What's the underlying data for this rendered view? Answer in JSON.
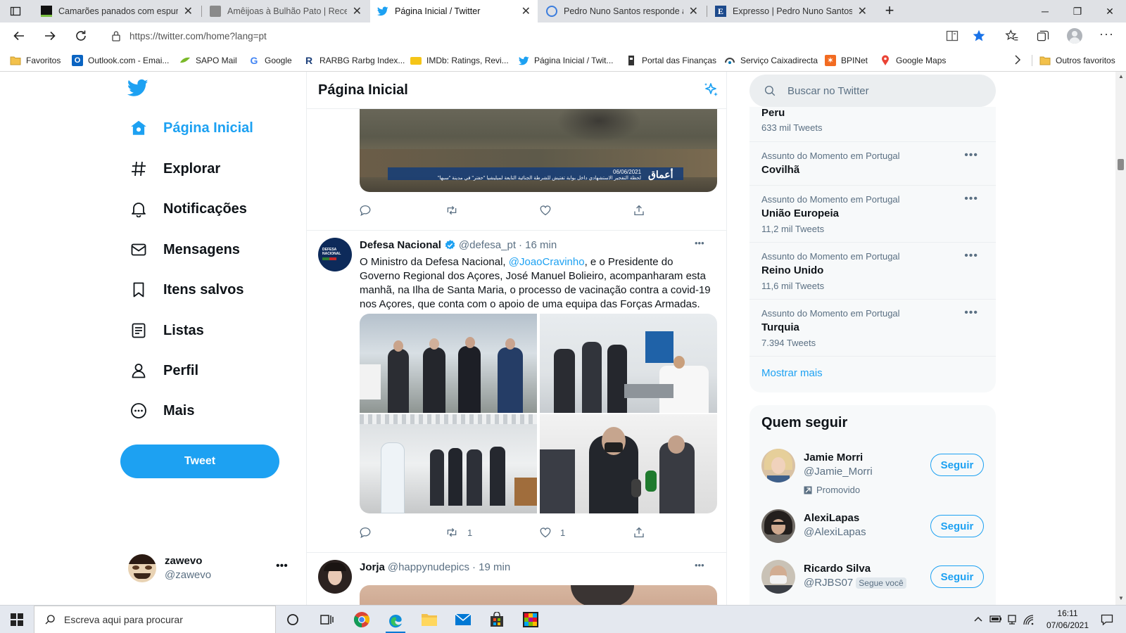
{
  "browser": {
    "tabs": [
      {
        "title": "Camarões panados com espuma",
        "favicon": "dark-green-icon",
        "active": false
      },
      {
        "title": "Amêijoas à Bulhão Pato | Receita",
        "favicon": "gray-image-icon",
        "active": false
      },
      {
        "title": "Página Inicial / Twitter",
        "favicon": "twitter-bird-icon",
        "active": true
      },
      {
        "title": "Pedro Nuno Santos responde a",
        "favicon": "blue-circle-icon",
        "active": false
      },
      {
        "title": "Expresso | Pedro Nuno Santos vs",
        "favicon": "expresso-e-icon",
        "active": false
      }
    ],
    "url": "https://twitter.com/home?lang=pt",
    "favorites": [
      {
        "label": "Favoritos",
        "icon": "folder-icon"
      },
      {
        "label": "Outlook.com - Emai...",
        "icon": "outlook-icon"
      },
      {
        "label": "SAPO Mail",
        "icon": "sapo-icon"
      },
      {
        "label": "Google",
        "icon": "google-g-icon"
      },
      {
        "label": "RARBG Rarbg Index...",
        "icon": "rarbg-icon"
      },
      {
        "label": "IMDb: Ratings, Revi...",
        "icon": "imdb-icon"
      },
      {
        "label": "Página Inicial / Twit...",
        "icon": "twitter-bird-icon"
      },
      {
        "label": "Portal das Finanças",
        "icon": "financas-icon"
      },
      {
        "label": "Serviço Caixadirecta",
        "icon": "caixa-icon"
      },
      {
        "label": "BPINet",
        "icon": "bpi-icon"
      },
      {
        "label": "Google Maps",
        "icon": "maps-pin-icon"
      }
    ],
    "other_favorites": "Outros favoritos"
  },
  "sidebar": {
    "items": [
      {
        "label": "Página Inicial",
        "icon": "home-icon",
        "active": true
      },
      {
        "label": "Explorar",
        "icon": "hashtag-icon",
        "active": false
      },
      {
        "label": "Notificações",
        "icon": "bell-icon",
        "active": false
      },
      {
        "label": "Mensagens",
        "icon": "envelope-icon",
        "active": false
      },
      {
        "label": "Itens salvos",
        "icon": "bookmark-icon",
        "active": false
      },
      {
        "label": "Listas",
        "icon": "list-icon",
        "active": false
      },
      {
        "label": "Perfil",
        "icon": "person-icon",
        "active": false
      },
      {
        "label": "Mais",
        "icon": "more-circle-icon",
        "active": false
      }
    ],
    "tweet_button": "Tweet",
    "account": {
      "name": "zawevo",
      "handle": "@zawevo"
    }
  },
  "timeline": {
    "title": "Página Inicial",
    "prev_tweet": {
      "video_date": "06/06/2021",
      "video_caption": "لحظة التفجير الاستشهادي داخل بوابة تفتيش للشرطة الجنائية التابعة لميليشيا \"حفتر\" في مدينة \"سبها\"",
      "video_logo": "أعماق"
    },
    "tweets": [
      {
        "name": "Defesa Nacional",
        "verified": true,
        "handle": "@defesa_pt",
        "time": "· 16 min",
        "avatar_text": "DEFESA NACIONAL",
        "text_before": "O Ministro da Defesa Nacional, ",
        "mention": "@JoaoCravinho",
        "text_after": ", e o Presidente do Governo Regional dos Açores, José Manuel Bolieiro, acompanharam esta manhã, na Ilha de Santa Maria, o processo de vacinação contra a covid-19 nos Açores, que conta com o apoio de uma equipa das Forças Armadas.",
        "retweets": "1",
        "likes": "1"
      },
      {
        "name": "Jorja",
        "handle": "@happynudepics",
        "time": "· 19 min"
      }
    ]
  },
  "search": {
    "placeholder": "Buscar no Twitter"
  },
  "trends": {
    "items": [
      {
        "category": "",
        "name": "Peru",
        "count": "633 mil Tweets"
      },
      {
        "category": "Assunto do Momento em Portugal",
        "name": "Covilhã",
        "count": ""
      },
      {
        "category": "Assunto do Momento em Portugal",
        "name": "União Europeia",
        "count": "11,2 mil Tweets"
      },
      {
        "category": "Assunto do Momento em Portugal",
        "name": "Reino Unido",
        "count": "11,6 mil Tweets"
      },
      {
        "category": "Assunto do Momento em Portugal",
        "name": "Turquia",
        "count": "7.394 Tweets"
      }
    ],
    "show_more": "Mostrar mais"
  },
  "who_to_follow": {
    "title": "Quem seguir",
    "users": [
      {
        "name": "Jamie Morri",
        "handle": "@Jamie_Morri",
        "promoted": "Promovido",
        "button": "Seguir"
      },
      {
        "name": "AlexiLapas",
        "handle": "@AlexiLapas",
        "button": "Seguir"
      },
      {
        "name": "Ricardo Silva",
        "handle": "@RJBS07",
        "follows_you": "Segue você",
        "button": "Seguir"
      }
    ]
  },
  "taskbar": {
    "search_placeholder": "Escreva aqui para procurar",
    "time": "16:11",
    "date": "07/06/2021"
  },
  "colors": {
    "twitter_blue": "#1da1f2",
    "text": "#0f1419",
    "muted": "#5b7083"
  }
}
